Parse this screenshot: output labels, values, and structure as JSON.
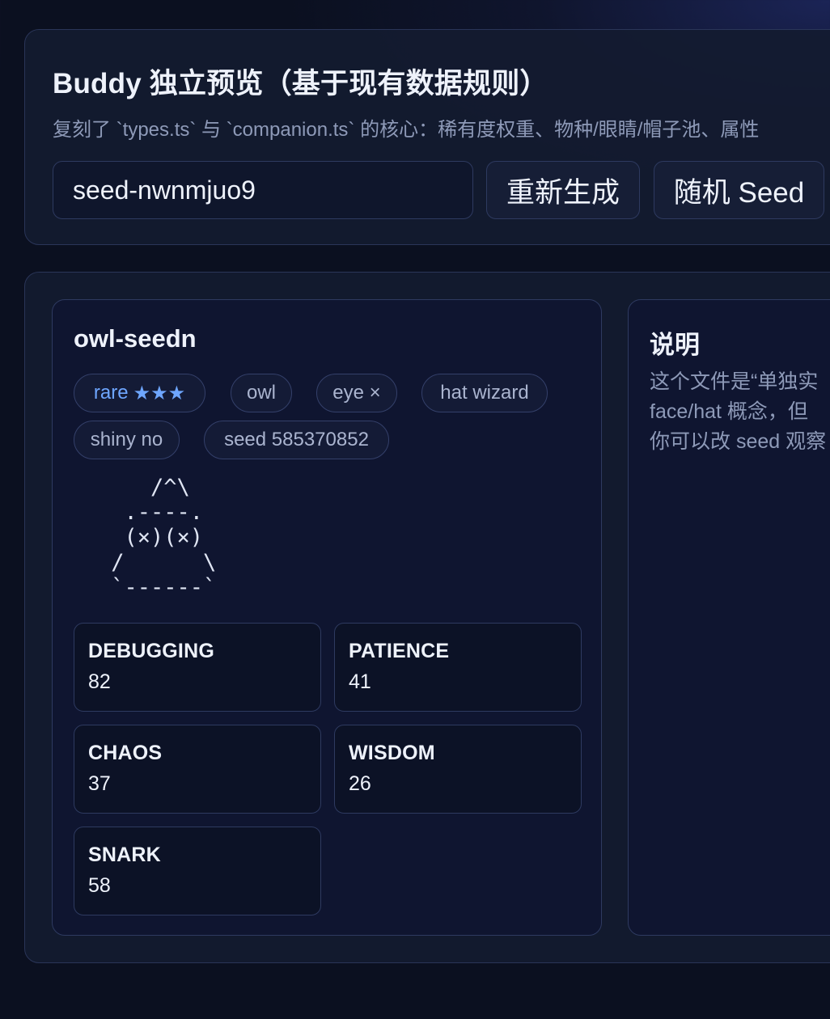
{
  "header": {
    "title": "Buddy 独立预览（基于现有数据规则）",
    "subtitle": "复刻了 `types.ts` 与 `companion.ts` 的核心：稀有度权重、物种/眼睛/帽子池、属性",
    "seed_input_value": "seed-nwnmjuo9",
    "regenerate_label": "重新生成",
    "random_seed_label": "随机 Seed"
  },
  "buddy": {
    "name": "owl-seedn",
    "tags": {
      "rarity": "rare",
      "rarity_stars": "★★★",
      "species": "owl",
      "eye": "eye ×",
      "hat": "hat wizard",
      "shiny": "shiny no",
      "seed": "seed 585370852"
    },
    "ascii_art": "    /^\\\n  .----.\n  (×)(×)\n /      \\\n `------`",
    "stats": [
      {
        "label": "DEBUGGING",
        "value": "82"
      },
      {
        "label": "PATIENCE",
        "value": "41"
      },
      {
        "label": "CHAOS",
        "value": "37"
      },
      {
        "label": "WISDOM",
        "value": "26"
      },
      {
        "label": "SNARK",
        "value": "58"
      }
    ]
  },
  "note": {
    "title": "说明",
    "lines": [
      "这个文件是“单独实",
      "face/hat 概念，但",
      "你可以改 seed 观察"
    ]
  },
  "colors": {
    "background": "#0b1020",
    "panel": "#141b30",
    "card": "#0f1530",
    "accent_rare": "#6ea6ff",
    "muted_text": "#8e9ab8"
  }
}
